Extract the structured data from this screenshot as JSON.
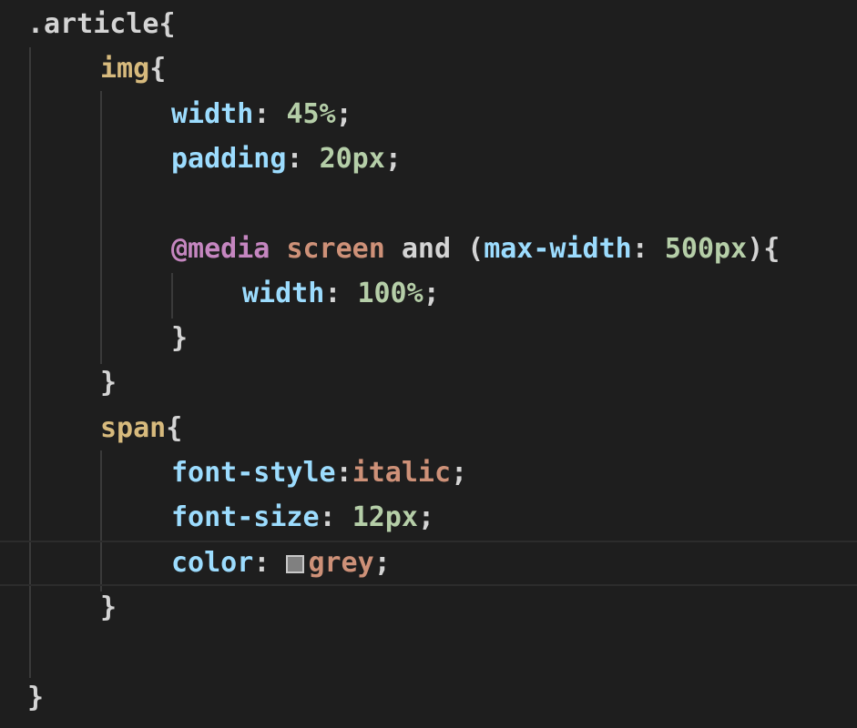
{
  "colors": {
    "background": "#1e1e1e",
    "selector": "#d7ba7d",
    "property": "#9cdcfe",
    "number": "#b5cea8",
    "keyword_value": "#ce9178",
    "at_rule": "#c586c0",
    "punctuation": "#d4d4d4",
    "swatch": "#808080"
  },
  "lines": [
    {
      "indent": 1,
      "tokens": [
        {
          "t": ".article",
          "c": "punctuation"
        },
        {
          "t": "{",
          "c": "punctuation"
        }
      ]
    },
    {
      "indent": 2,
      "tokens": [
        {
          "t": "img",
          "c": "selector"
        },
        {
          "t": "{",
          "c": "punctuation"
        }
      ]
    },
    {
      "indent": 3,
      "tokens": [
        {
          "t": "width",
          "c": "property"
        },
        {
          "t": ": ",
          "c": "punctuation"
        },
        {
          "t": "45%",
          "c": "number"
        },
        {
          "t": ";",
          "c": "punctuation"
        }
      ]
    },
    {
      "indent": 3,
      "tokens": [
        {
          "t": "padding",
          "c": "property"
        },
        {
          "t": ": ",
          "c": "punctuation"
        },
        {
          "t": "20px",
          "c": "number"
        },
        {
          "t": ";",
          "c": "punctuation"
        }
      ]
    },
    {
      "indent": 0,
      "tokens": []
    },
    {
      "indent": 3,
      "tokens": [
        {
          "t": "@media",
          "c": "at_rule"
        },
        {
          "t": " ",
          "c": "punctuation"
        },
        {
          "t": "screen",
          "c": "keyword_value"
        },
        {
          "t": " and (",
          "c": "punctuation"
        },
        {
          "t": "max-width",
          "c": "property"
        },
        {
          "t": ": ",
          "c": "punctuation"
        },
        {
          "t": "500px",
          "c": "number"
        },
        {
          "t": "){",
          "c": "punctuation"
        }
      ]
    },
    {
      "indent": 4,
      "tokens": [
        {
          "t": "width",
          "c": "property"
        },
        {
          "t": ": ",
          "c": "punctuation"
        },
        {
          "t": "100%",
          "c": "number"
        },
        {
          "t": ";",
          "c": "punctuation"
        }
      ]
    },
    {
      "indent": 3,
      "tokens": [
        {
          "t": "}",
          "c": "punctuation"
        }
      ]
    },
    {
      "indent": 2,
      "tokens": [
        {
          "t": "}",
          "c": "punctuation"
        }
      ]
    },
    {
      "indent": 2,
      "tokens": [
        {
          "t": "span",
          "c": "selector"
        },
        {
          "t": "{",
          "c": "punctuation"
        }
      ]
    },
    {
      "indent": 3,
      "tokens": [
        {
          "t": "font-style",
          "c": "property"
        },
        {
          "t": ":",
          "c": "punctuation"
        },
        {
          "t": "italic",
          "c": "keyword_value"
        },
        {
          "t": ";",
          "c": "punctuation"
        }
      ]
    },
    {
      "indent": 3,
      "tokens": [
        {
          "t": "font-size",
          "c": "property"
        },
        {
          "t": ": ",
          "c": "punctuation"
        },
        {
          "t": "12px",
          "c": "number"
        },
        {
          "t": ";",
          "c": "punctuation"
        }
      ]
    },
    {
      "indent": 3,
      "current": true,
      "tokens": [
        {
          "t": "color",
          "c": "property"
        },
        {
          "t": ": ",
          "c": "punctuation"
        },
        {
          "swatch": true
        },
        {
          "t": "grey",
          "c": "keyword_value"
        },
        {
          "t": ";",
          "c": "punctuation"
        }
      ]
    },
    {
      "indent": 2,
      "tokens": [
        {
          "t": "}",
          "c": "punctuation"
        }
      ]
    },
    {
      "indent": 0,
      "tokens": []
    },
    {
      "indent": 1,
      "tokens": [
        {
          "t": "}",
          "c": "punctuation"
        }
      ]
    }
  ]
}
